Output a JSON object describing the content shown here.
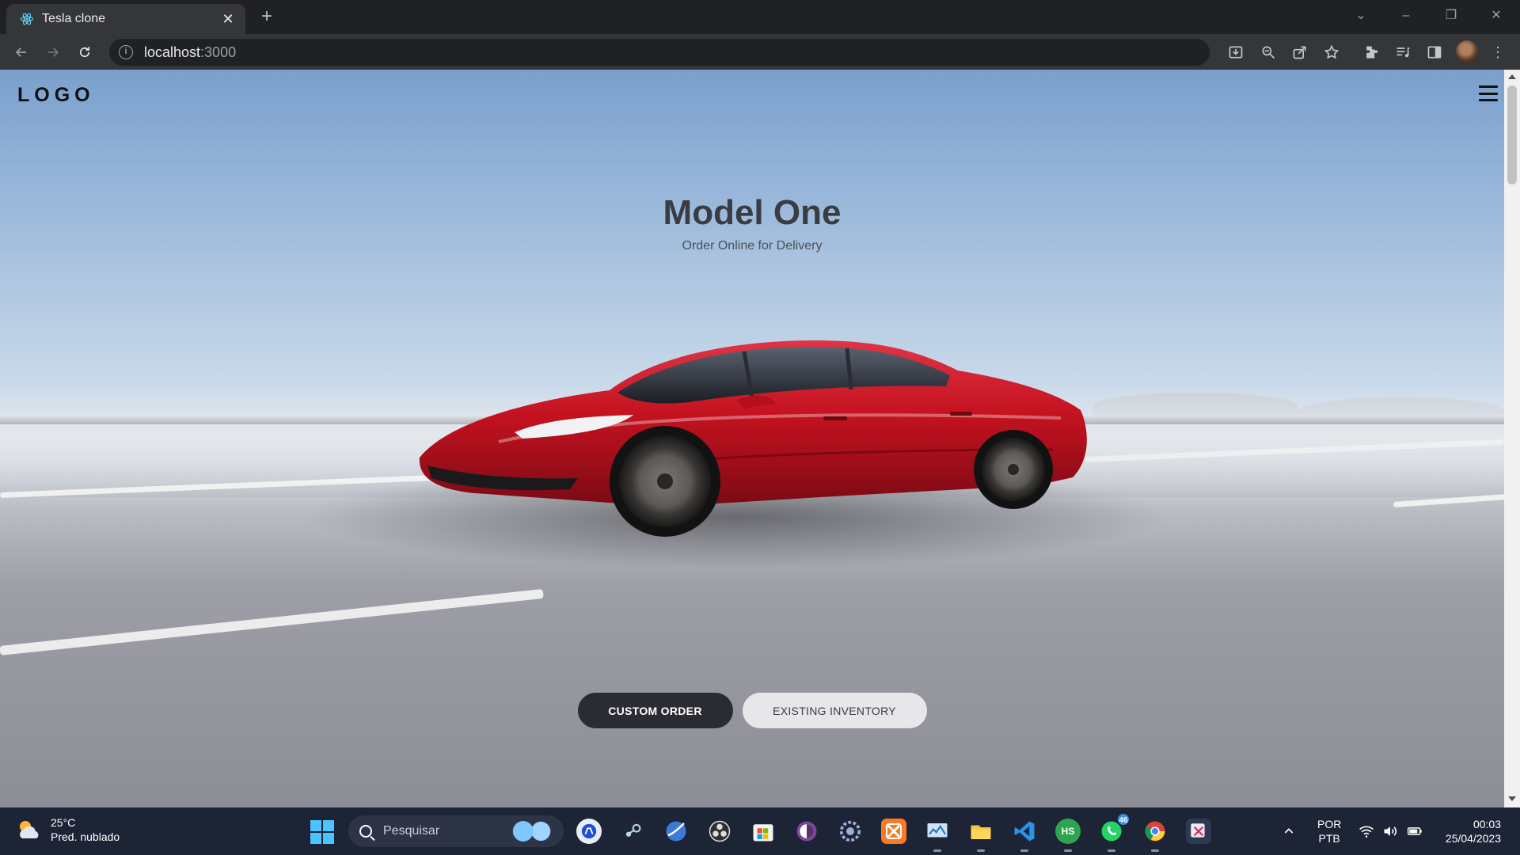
{
  "browser": {
    "tab_title": "Tesla clone",
    "new_tab_label": "+",
    "url_host": "localhost",
    "url_port": ":3000"
  },
  "page": {
    "logo": "LOGO",
    "hero_title": "Model One",
    "hero_subtitle": "Order Online for Delivery",
    "primary_button": "CUSTOM ORDER",
    "secondary_button": "EXISTING INVENTORY",
    "colors": {
      "car_red": "#c4121f",
      "primary_button": "#2b2c33",
      "title_text": "#393c41"
    }
  },
  "taskbar": {
    "weather_temp": "25°C",
    "weather_desc": "Pred. nublado",
    "search_placeholder": "Pesquisar",
    "whatsapp_badge": "46",
    "hubstaff_label": "HS",
    "lang_primary": "POR",
    "lang_secondary": "PTB",
    "time": "00:03",
    "date": "25/04/2023",
    "apps": [
      "copilot-icon",
      "steam-icon",
      "browser-icon",
      "obs-icon",
      "store-icon",
      "tor-icon",
      "settings-icon",
      "xampp-icon",
      "monitor-icon",
      "file-explorer-icon",
      "vscode-icon",
      "hubstaff-icon",
      "whatsapp-icon",
      "chrome-icon",
      "snipping-tool-icon"
    ]
  }
}
